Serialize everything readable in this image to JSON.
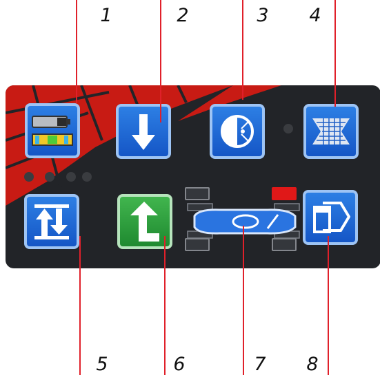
{
  "callouts": {
    "top": [
      "1",
      "2",
      "3",
      "4"
    ],
    "bottom": [
      "5",
      "6",
      "7",
      "8"
    ]
  },
  "colors": {
    "panel": "#222428",
    "accent_stripe": "#c81b14",
    "key_blue": "#1f6bd8",
    "key_green": "#2fa43f",
    "leader_line": "#e0202a",
    "status_red": "#e01818"
  },
  "keys": [
    {
      "id": "battery-level",
      "icon": "battery-and-spirit-level-icon"
    },
    {
      "id": "lower",
      "icon": "arrow-down-icon"
    },
    {
      "id": "recall",
      "icon": "circle-arc-icon"
    },
    {
      "id": "tread",
      "icon": "tire-tread-icon"
    },
    {
      "id": "raise-lower",
      "icon": "up-down-arrows-icon"
    },
    {
      "id": "raise",
      "icon": "arrow-up-icon"
    },
    {
      "id": "vehicle-status",
      "icon": "vehicle-outline-icon"
    },
    {
      "id": "exit",
      "icon": "exit-document-icon"
    }
  ]
}
